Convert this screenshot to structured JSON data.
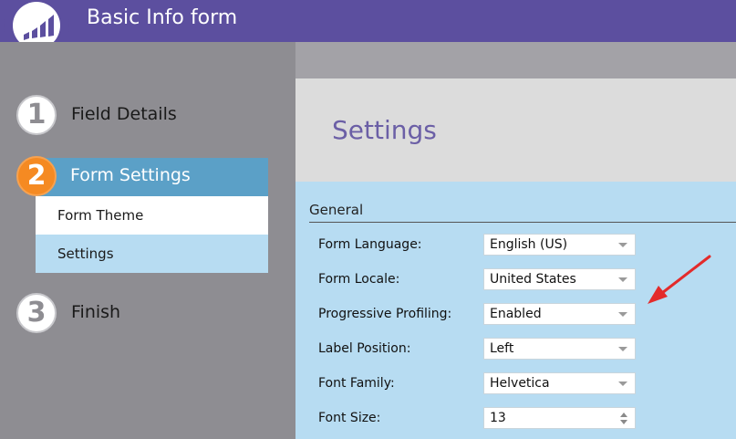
{
  "app": {
    "title": "Basic Info form"
  },
  "steps": [
    {
      "number": "1",
      "label": "Field Details"
    },
    {
      "number": "2",
      "label": "Form Settings",
      "sub_items": [
        "Form Theme",
        "Settings"
      ]
    },
    {
      "number": "3",
      "label": "Finish"
    }
  ],
  "settings": {
    "title": "Settings",
    "section": "General",
    "fields": [
      {
        "label": "Form Language:",
        "value": "English (US)"
      },
      {
        "label": "Form Locale:",
        "value": "United States"
      },
      {
        "label": "Progressive Profiling:",
        "value": "Enabled"
      },
      {
        "label": "Label Position:",
        "value": "Left"
      },
      {
        "label": "Font Family:",
        "value": "Helvetica"
      },
      {
        "label": "Font Size:",
        "value": "13"
      }
    ]
  },
  "colors": {
    "header": "#5c4f9f",
    "active_step": "#f58a22",
    "active_bar": "#5ba0c7",
    "panel_body": "#b7dcf2",
    "annotation_arrow": "#e32b2b"
  },
  "icons": {
    "logo": "bar-chart-logo-icon",
    "annotation": "red-arrow-icon"
  }
}
